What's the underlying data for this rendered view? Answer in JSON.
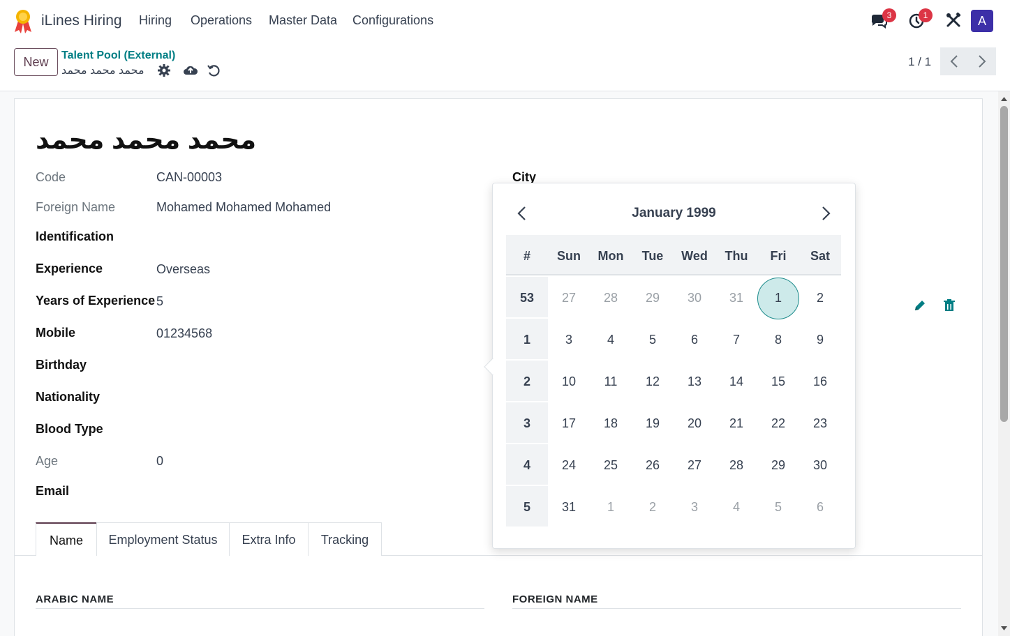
{
  "app": {
    "name": "iLines Hiring",
    "menu": [
      "Hiring",
      "Operations",
      "Master Data",
      "Configurations"
    ],
    "messages_badge": "3",
    "activities_badge": "1",
    "avatar_letter": "A",
    "accent_color": "#017e84"
  },
  "control": {
    "new_label": "New",
    "breadcrumb": "Talent Pool (External)",
    "record_name": "محمد محمد محمد",
    "pager": "1 / 1"
  },
  "form": {
    "title": "محمد محمد محمد",
    "fields": {
      "code_label": "Code",
      "code_value": "CAN-00003",
      "foreign_name_label": "Foreign Name",
      "foreign_name_value": "Mohamed Mohamed Mohamed",
      "identification_label": "Identification",
      "experience_label": "Experience",
      "experience_value": "Overseas",
      "years_label": "Years of Experience",
      "years_value": "5",
      "mobile_label": "Mobile",
      "mobile_value": "01234568",
      "birthday_label": "Birthday",
      "nationality_label": "Nationality",
      "blood_label": "Blood Type",
      "age_label": "Age",
      "age_value": "0",
      "email_label": "Email",
      "city_label": "City"
    },
    "tabs": [
      "Name",
      "Employment Status",
      "Extra Info",
      "Tracking"
    ],
    "sections": {
      "arabic": "ARABIC NAME",
      "foreign": "FOREIGN NAME"
    }
  },
  "datepicker": {
    "month_title": "January 1999",
    "week_header": "#",
    "days_of_week": [
      "Sun",
      "Mon",
      "Tue",
      "Wed",
      "Thu",
      "Fri",
      "Sat"
    ],
    "weeks": [
      {
        "num": "53",
        "days": [
          "27",
          "28",
          "29",
          "30",
          "31",
          "1",
          "2"
        ]
      },
      {
        "num": "1",
        "days": [
          "3",
          "4",
          "5",
          "6",
          "7",
          "8",
          "9"
        ]
      },
      {
        "num": "2",
        "days": [
          "10",
          "11",
          "12",
          "13",
          "14",
          "15",
          "16"
        ]
      },
      {
        "num": "3",
        "days": [
          "17",
          "18",
          "19",
          "20",
          "21",
          "22",
          "23"
        ]
      },
      {
        "num": "4",
        "days": [
          "24",
          "25",
          "26",
          "27",
          "28",
          "29",
          "30"
        ]
      },
      {
        "num": "5",
        "days": [
          "31",
          "1",
          "2",
          "3",
          "4",
          "5",
          "6"
        ]
      }
    ],
    "selected": "1"
  }
}
